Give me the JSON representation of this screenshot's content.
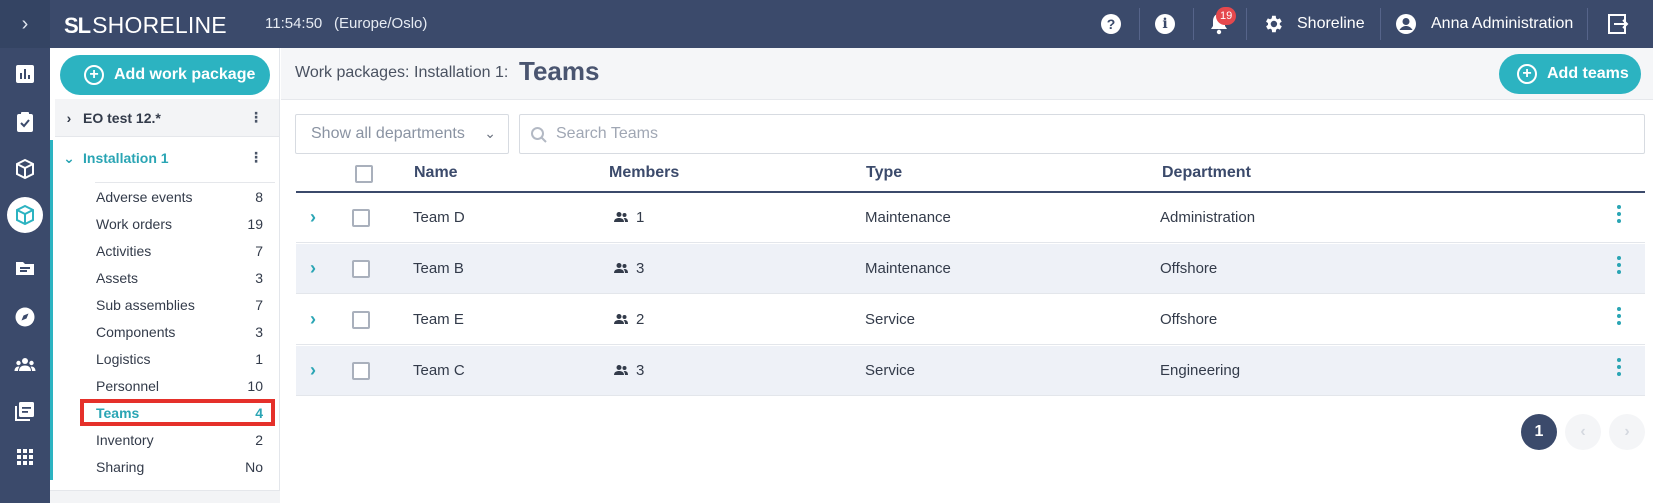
{
  "topbar": {
    "brand_mark": "SL",
    "brand_name": "SHORELINE",
    "time": "11:54:50",
    "timezone": "(Europe/Oslo)",
    "notification_count": "19",
    "org_name": "Shoreline",
    "user_name": "Anna Administration"
  },
  "sidebar": {
    "add_label": "Add work package",
    "packages": [
      {
        "name": "EO test 12.*",
        "expanded": false
      },
      {
        "name": "Installation 1",
        "expanded": true
      }
    ],
    "items": [
      {
        "label": "Adverse events",
        "count": "8"
      },
      {
        "label": "Work orders",
        "count": "19"
      },
      {
        "label": "Activities",
        "count": "7"
      },
      {
        "label": "Assets",
        "count": "3"
      },
      {
        "label": "Sub assemblies",
        "count": "7"
      },
      {
        "label": "Components",
        "count": "3"
      },
      {
        "label": "Logistics",
        "count": "1"
      },
      {
        "label": "Personnel",
        "count": "10"
      },
      {
        "label": "Teams",
        "count": "4"
      },
      {
        "label": "Inventory",
        "count": "2"
      },
      {
        "label": "Sharing",
        "count": "No"
      }
    ]
  },
  "header": {
    "crumb_root": "Work packages:",
    "crumb_parent": "Installation 1:",
    "title": "Teams",
    "add_label": "Add teams"
  },
  "filters": {
    "department_value": "Show all departments",
    "search_placeholder": "Search Teams"
  },
  "table": {
    "columns": [
      "Name",
      "Members",
      "Type",
      "Department"
    ],
    "rows": [
      {
        "name": "Team D",
        "members": "1",
        "type": "Maintenance",
        "department": "Administration"
      },
      {
        "name": "Team B",
        "members": "3",
        "type": "Maintenance",
        "department": "Offshore"
      },
      {
        "name": "Team E",
        "members": "2",
        "type": "Service",
        "department": "Offshore"
      },
      {
        "name": "Team C",
        "members": "3",
        "type": "Service",
        "department": "Engineering"
      }
    ]
  },
  "pagination": {
    "current": "1"
  },
  "colors": {
    "accent": "#2cb3c1",
    "nav": "#3b4a6b",
    "highlight": "#e5302a",
    "badge": "#e5484d"
  }
}
